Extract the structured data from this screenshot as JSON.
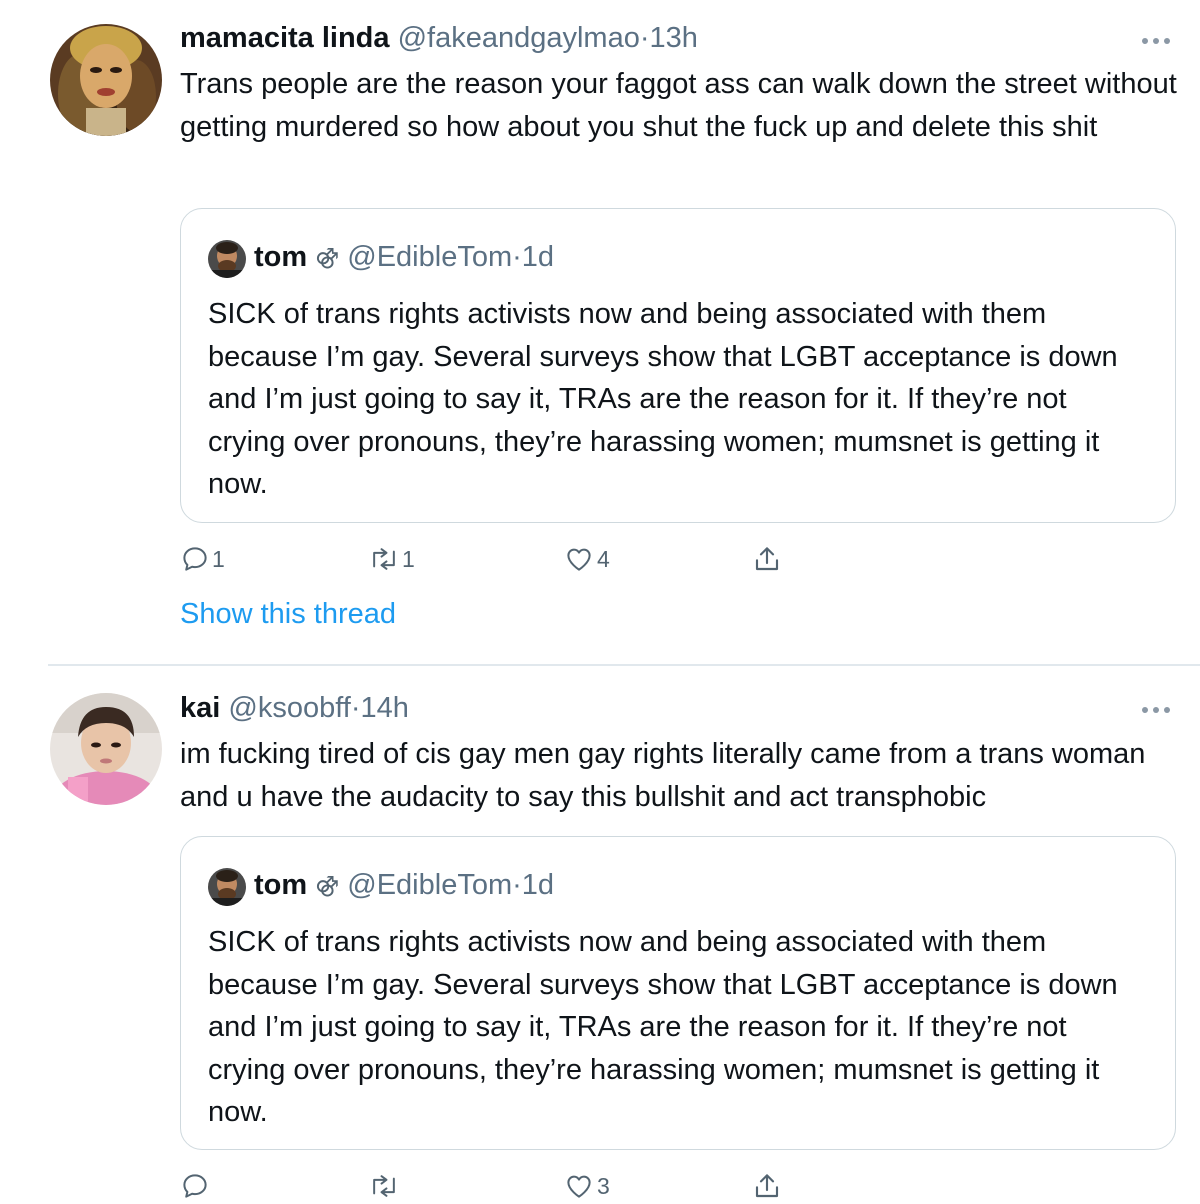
{
  "tweets": [
    {
      "display_name": "mamacita linda",
      "handle": "@fakeandgaylmao",
      "separator": "·",
      "time": "13h",
      "text": "Trans people are the reason your faggot ass can walk down the street without getting murdered so how about you shut the fuck up and delete this shit",
      "quote": {
        "display_name": "tom",
        "badge": "⚣",
        "handle": "@EdibleTom",
        "separator": "·",
        "time": "1d",
        "text": "SICK of trans rights activists now and being associated with them because I’m gay. Several surveys show that LGBT acceptance is down and I’m just going to say it, TRAs are the reason for it. If they’re not crying over pronouns, they’re harassing women; mumsnet is getting it now."
      },
      "actions": {
        "reply_count": "1",
        "retweet_count": "1",
        "like_count": "4",
        "share_count": ""
      },
      "show_thread": "Show this thread"
    },
    {
      "display_name": "kai",
      "handle": "@ksoobff",
      "separator": "·",
      "time": "14h",
      "text": "im fucking tired of cis gay men gay rights literally came from a trans woman and u have the audacity to say this bullshit and act transphobic",
      "quote": {
        "display_name": "tom",
        "badge": "⚣",
        "handle": "@EdibleTom",
        "separator": "·",
        "time": "1d",
        "text": "SICK of trans rights activists now and being associated with them because I’m gay. Several surveys show that LGBT acceptance is down and I’m just going to say it, TRAs are the reason for it. If they’re not crying over pronouns, they’re harassing women; mumsnet is getting it now."
      },
      "actions": {
        "reply_count": "",
        "retweet_count": "",
        "like_count": "3",
        "share_count": ""
      }
    }
  ],
  "colors": {
    "text_primary": "#0f1419",
    "text_secondary": "#5b7083",
    "link_blue": "#1d9bf0",
    "border": "#cfd9de",
    "divider": "#e1e8ed"
  },
  "icons": {
    "more": "more-horizontal-icon",
    "reply": "reply-icon",
    "retweet": "retweet-icon",
    "like": "heart-icon",
    "share": "share-icon"
  }
}
